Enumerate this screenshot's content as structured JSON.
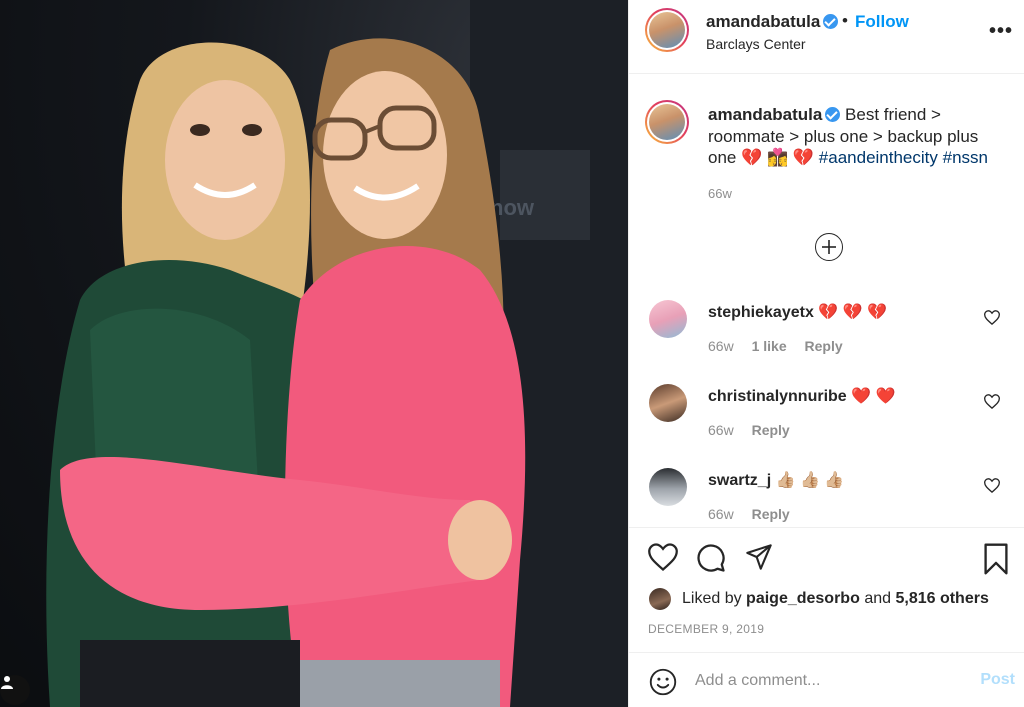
{
  "post": {
    "username": "amandabatula",
    "location": "Barclays Center",
    "follow_label": "Follow",
    "bullet": "•",
    "more": "•••"
  },
  "caption": {
    "username": "amandabatula",
    "text": "Best friend > roommate > plus one > backup plus one",
    "emojis": "💔 👩‍❤️‍💋‍👩 💔",
    "hashtags": [
      "#aandeinthecity",
      "#nssn"
    ],
    "time": "66w"
  },
  "comments": [
    {
      "username": "stephiekayetx",
      "emojis": "💔 💔 💔",
      "time": "66w",
      "likes": "1 like",
      "reply": "Reply"
    },
    {
      "username": "christinalynnuribe",
      "emojis": "❤️ ❤️",
      "time": "66w",
      "reply": "Reply"
    },
    {
      "username": "swartz_j",
      "emojis": "👍🏼 👍🏼 👍🏼",
      "time": "66w",
      "reply": "Reply"
    }
  ],
  "likes": {
    "prefix": "Liked by",
    "user": "paige_desorbo",
    "and": "and",
    "others": "5,816 others"
  },
  "date": "DECEMBER 9, 2019",
  "add_comment": {
    "placeholder": "Add a comment...",
    "post_label": "Post"
  },
  "icons": [
    "user-tag-icon",
    "heart-icon",
    "comment-icon",
    "share-icon",
    "bookmark-icon",
    "emoji-icon",
    "plus-circle-icon",
    "more-icon",
    "verified-icon"
  ],
  "colors": {
    "link": "#0095f6",
    "hashtag": "#00376b",
    "muted": "#8e8e8e",
    "post_disabled": "#b2dffc",
    "verified": "#3897f0"
  }
}
